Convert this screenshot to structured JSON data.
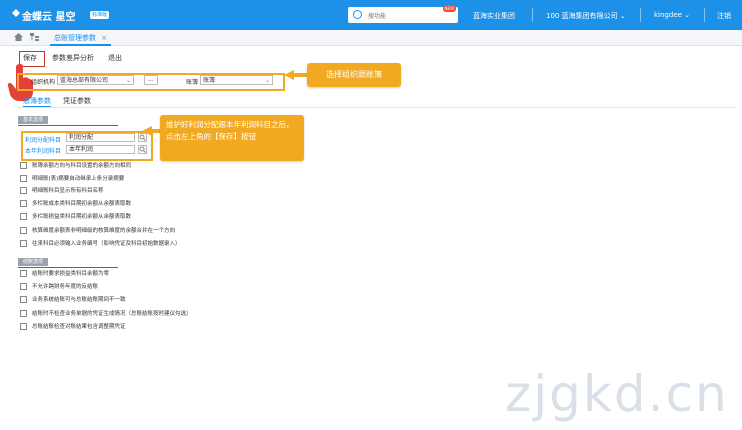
{
  "brand": {
    "name": "金蝶云 星空",
    "beta": "标准版"
  },
  "search": {
    "placeholder": "搜功能",
    "badge": "NEW"
  },
  "topnav": {
    "org_group": "蓝海实业集团",
    "company": "100 蓝海集团有限公司",
    "user": "kingdee",
    "logout": "注销"
  },
  "tabbar": {
    "active_tab": "总账管理参数",
    "close": "×"
  },
  "toolbar": {
    "save": "保存",
    "diff": "参数差异分析",
    "exit": "退出"
  },
  "filter": {
    "org_label": "组织机构",
    "org_value": "蓝海总部有限公司",
    "ellipsis": "...",
    "book_label": "账簿",
    "book_value": "账簿"
  },
  "subtabs": [
    "账簿参数",
    "凭证参数"
  ],
  "callouts": {
    "select": "选择组织跟账簿",
    "maintain": "维护好利润分配跟本年利润科目之后，点击左上角的【保存】按钮"
  },
  "basic": {
    "title": "基本选项",
    "profit_dist_label": "利润分配科目",
    "profit_dist_value": "利润分配",
    "current_profit_label": "本年利润科目",
    "current_profit_value": "本年利润",
    "options": [
      "账簿余额方向与科目设置的余额方向相同",
      "明细账(表)摘要自动继承上条分录摘要",
      "明细账科目显示所有科目名称",
      "多栏账成本类科目期初余额从余额表取数",
      "多栏账损益类科目期初余额从余额表取数",
      "核算维度余额表非明细级的核算维度的余额合并在一个方向",
      "往来科目必须输入业务编号（影响凭证及科目初始数据录入）"
    ]
  },
  "closing": {
    "title": "结账选项",
    "options": [
      "结账时要求损益类科目余额为零",
      "不允许跨财务年度的反结账",
      "业务系统结账可与总账结账期间不一致",
      "结账时不检查业务单据的凭证生成情况（总账结账按时建议勾选）",
      "总账结账检查对账结果包含调整期凭证"
    ]
  },
  "watermark": "zjgkd.cn",
  "colors": {
    "primary": "#1d90e8",
    "callout": "#f2a922",
    "save_highlight": "#c0392b"
  }
}
